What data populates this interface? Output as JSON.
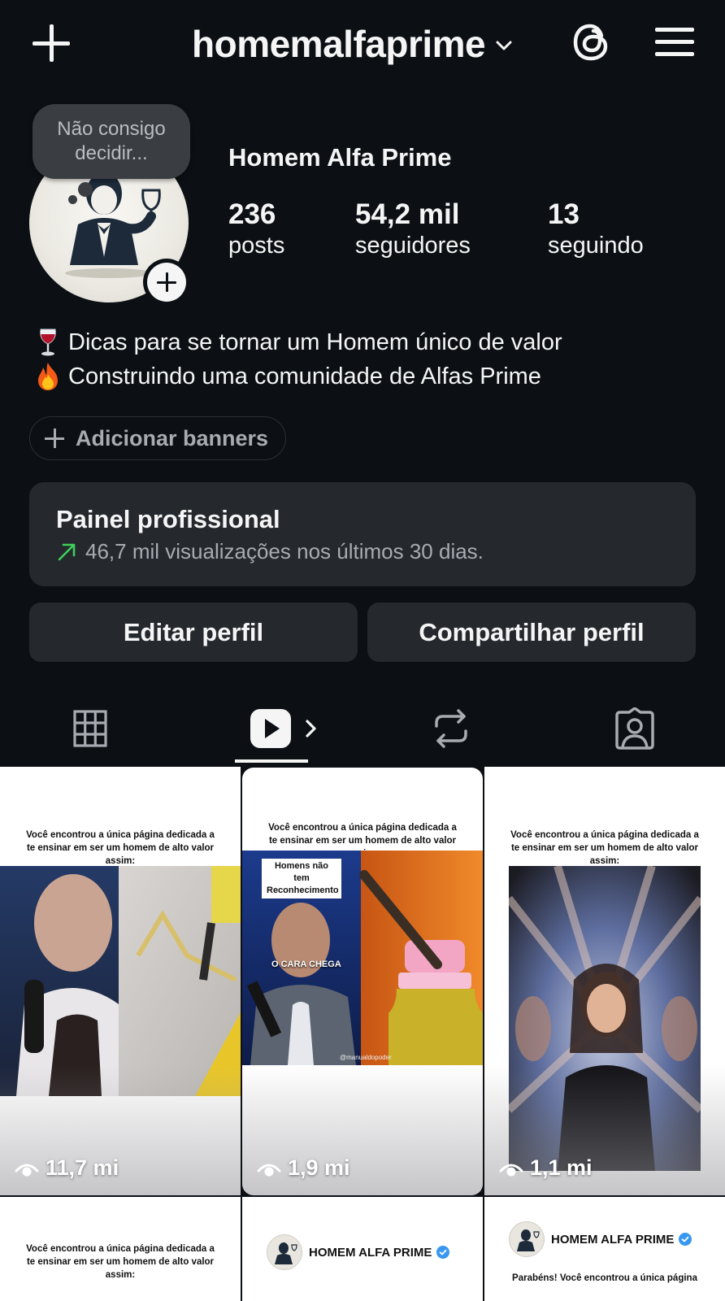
{
  "header": {
    "username": "homemalfaprime"
  },
  "profile": {
    "note": "Não consigo decidir...",
    "display_name": "Homem Alfa Prime",
    "stats": [
      {
        "value": "236",
        "label": "posts"
      },
      {
        "value": "54,2 mil",
        "label": "seguidores"
      },
      {
        "value": "13",
        "label": "seguindo"
      }
    ],
    "bio": [
      {
        "emoji": "wine-glass",
        "text": "Dicas para se tornar um Homem único de valor"
      },
      {
        "emoji": "fire",
        "text": "Construindo uma comunidade de Alfas Prime"
      }
    ],
    "add_banners_label": "Adicionar banners"
  },
  "pro_dashboard": {
    "title": "Painel profissional",
    "subtitle": "46,7 mil visualizações nos últimos 30 dias.",
    "trend_color": "#3ecf5a"
  },
  "actions": {
    "edit_label": "Editar perfil",
    "share_label": "Compartilhar perfil"
  },
  "tabs": [
    {
      "icon": "grid-icon",
      "active": false
    },
    {
      "icon": "reels-icon",
      "active": true
    },
    {
      "icon": "reposts-icon",
      "active": false
    },
    {
      "icon": "tagged-icon",
      "active": false
    }
  ],
  "reels": [
    {
      "caption": "Você encontrou a única página dedicada a te ensinar em ser um homem de alto valor assim:",
      "views": "11,7 mi"
    },
    {
      "caption": "Você encontrou a única página dedicada a te ensinar em ser um homem de alto valor assim:",
      "overlay_label": "Homens não tem Reconhecimento",
      "overlay_subtitle": "O CARA CHEGA",
      "watermark": "@manualdopoder",
      "views": "1,9 mi"
    },
    {
      "caption": "Você encontrou a única página dedicada a te ensinar em ser um homem de alto valor assim:",
      "views": "1,1 mi"
    },
    {
      "caption": "Você encontrou a única página dedicada a te ensinar em ser um homem de alto valor assim:"
    },
    {
      "brand": "HOMEM ALFA PRIME"
    },
    {
      "brand": "HOMEM ALFA PRIME",
      "caption": "Parabéns! Você encontrou a única página"
    }
  ],
  "colors": {
    "background": "#0c1014",
    "surface": "#25292e",
    "text": "#f5f5f5",
    "muted": "#a8acb2",
    "verified": "#3897f0"
  }
}
